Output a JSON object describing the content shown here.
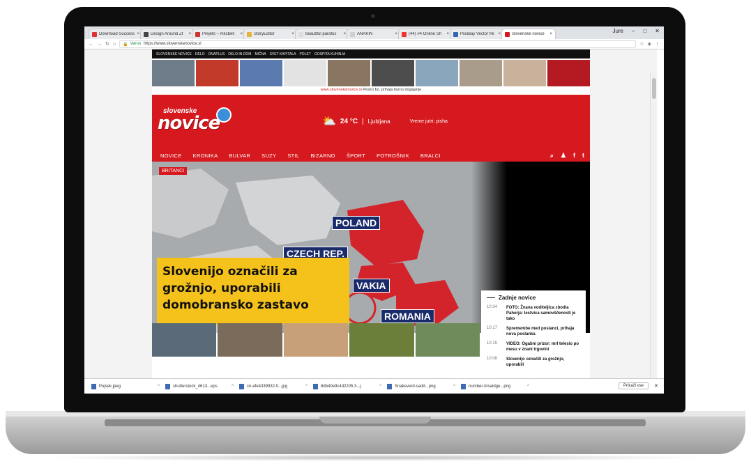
{
  "browser": {
    "tabs": [
      {
        "label": "Download Success",
        "color": "#d33"
      },
      {
        "label": "Design Around Zt",
        "color": "#444"
      },
      {
        "label": "Prejeto – mkcbell",
        "color": "#c33"
      },
      {
        "label": "StoryEditor",
        "color": "#e6b23a"
      },
      {
        "label": "beautiful parafus",
        "color": "#ddd"
      },
      {
        "label": "ANAKIN",
        "color": "#cfcfcf"
      },
      {
        "label": "(44) #4 Online Sh",
        "color": "#e33"
      },
      {
        "label": "Pixabay Vector fre",
        "color": "#3466b0"
      },
      {
        "label": "Slovenske novice",
        "color": "#d6191e"
      }
    ],
    "user": "Jure",
    "url": "https://www.slovenskenovice.si",
    "secure_label": "Varno"
  },
  "site": {
    "top_links": [
      "SLOVENSKE NOVICE",
      "DELO",
      "ONAPLUS",
      "DELO IN DOM",
      "MIČNA",
      "SVET KAPITALA",
      "POLET",
      "GOSPITA KUHINJA"
    ],
    "thumb_colors": [
      "#6f7c8a",
      "#c23a2a",
      "#5b7bb0",
      "#e3e3e3",
      "#8a7563",
      "#4d4d4d",
      "#8aa6bd",
      "#a99c8a",
      "#c9b29b",
      "#b31a22"
    ],
    "promo_prefix": "www.slovenskenovice.si",
    "promo_text": "Pestro bo, prihaja burno dogajanje",
    "logo_small": "slovenske",
    "logo_big": "novice",
    "weather_temp": "24 °C",
    "weather_city": "Ljubljana",
    "weather_forecast": "Vreme jutri: pisha",
    "nav": [
      "NOVICE",
      "KRONIKA",
      "BULVAR",
      "SUZY",
      "STIL",
      "BIZARNO",
      "ŠPORT",
      "POTROŠNIK",
      "BRALCI"
    ],
    "hero_tag": "BRITANCI",
    "countries": [
      "POLAND",
      "CZECH REP.",
      "VAKIA",
      "ROMANIA"
    ],
    "headline": "Slovenijo označili za grožnjo, uporabili domobransko zastavo",
    "latest_title": "Zadnje novice",
    "latest": [
      {
        "time": "10:34",
        "text": "FOTO: Žnana voditeljica zbodla Pahorja: lestvica samovščenosti je tako"
      },
      {
        "time": "10:17",
        "text": "Spremembe med poslanci, prihaja nova poslanka"
      },
      {
        "time": "10:15",
        "text": "VIDEO: Ogabni prizor: mrl telesio po mesu v znani trgovini"
      },
      {
        "time": "10:08",
        "text": "Slovenijo označili za grožnjo, uporabili"
      }
    ],
    "strip_colors": [
      "#5a6a78",
      "#7a6b5b",
      "#c7a079",
      "#6b7f3a",
      "#6f8a5b"
    ]
  },
  "downloads": [
    "Pujsek.jpeg",
    "shutterstock_4613...eps",
    "cn-efe4339932.0...jpg",
    "8db40e9c4d2205.3...j",
    "Snakeverd-sadd...png",
    "number-brsaidge...png"
  ],
  "show_all": "Prikaži vse"
}
